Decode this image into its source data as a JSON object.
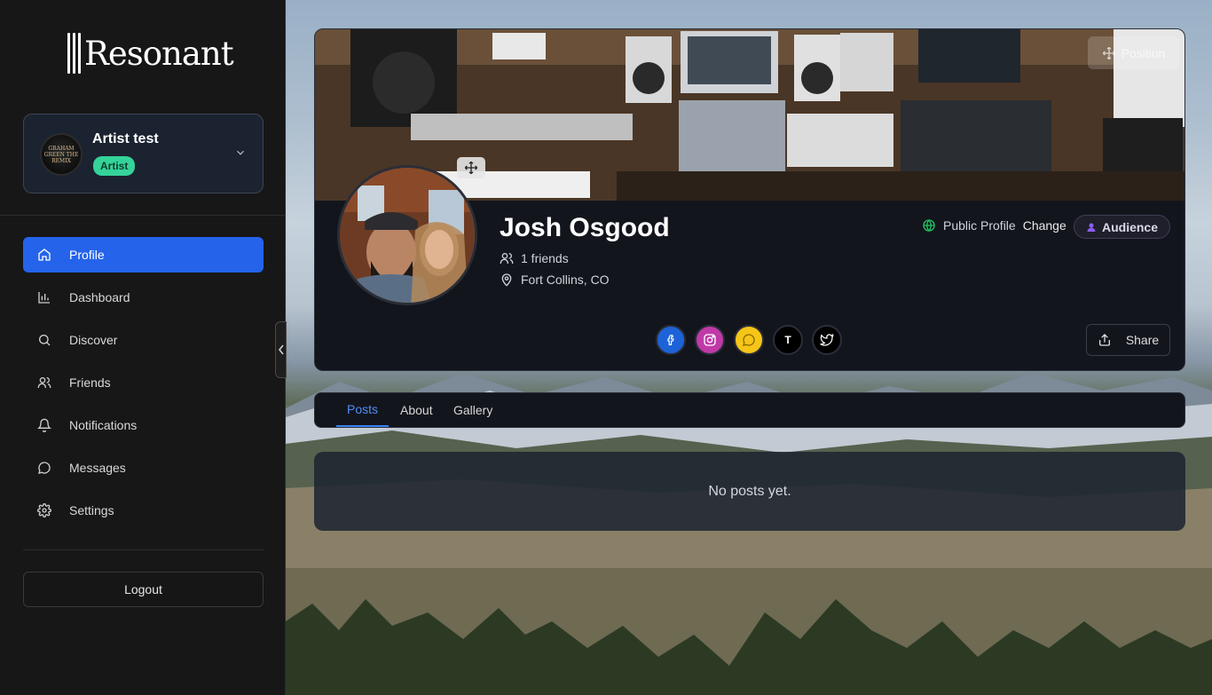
{
  "app": {
    "name": "Resonant"
  },
  "account": {
    "name": "Artist test",
    "role": "Artist",
    "avatar_text": "GRAHAM GREEN THE REMIX"
  },
  "nav": {
    "items": [
      {
        "label": "Profile",
        "icon": "home-icon",
        "active": true
      },
      {
        "label": "Dashboard",
        "icon": "bar-chart-icon",
        "active": false
      },
      {
        "label": "Discover",
        "icon": "search-icon",
        "active": false
      },
      {
        "label": "Friends",
        "icon": "users-icon",
        "active": false
      },
      {
        "label": "Notifications",
        "icon": "bell-icon",
        "active": false
      },
      {
        "label": "Messages",
        "icon": "message-icon",
        "active": false
      },
      {
        "label": "Settings",
        "icon": "gear-icon",
        "active": false
      }
    ],
    "logout_label": "Logout"
  },
  "profile": {
    "position_label": "Position",
    "name": "Josh Osgood",
    "friends": "1 friends",
    "location": "Fort Collins, CO",
    "visibility_label": "Public Profile",
    "change_label": "Change",
    "audience_label": "Audience",
    "share_label": "Share",
    "socials": [
      {
        "name": "facebook",
        "color": "#1d63d8"
      },
      {
        "name": "instagram",
        "color": "#c039a8"
      },
      {
        "name": "chat",
        "color": "#f5c518"
      },
      {
        "name": "tiktok",
        "color": "#000000",
        "glyph": "T"
      },
      {
        "name": "twitter",
        "color": "#000000"
      }
    ]
  },
  "tabs": [
    {
      "label": "Posts",
      "active": true
    },
    {
      "label": "About",
      "active": false
    },
    {
      "label": "Gallery",
      "active": false
    }
  ],
  "posts": {
    "empty_text": "No posts yet."
  },
  "colors": {
    "accent": "#2563eb",
    "badge": "#34d399",
    "tab_active": "#3b82f6"
  }
}
